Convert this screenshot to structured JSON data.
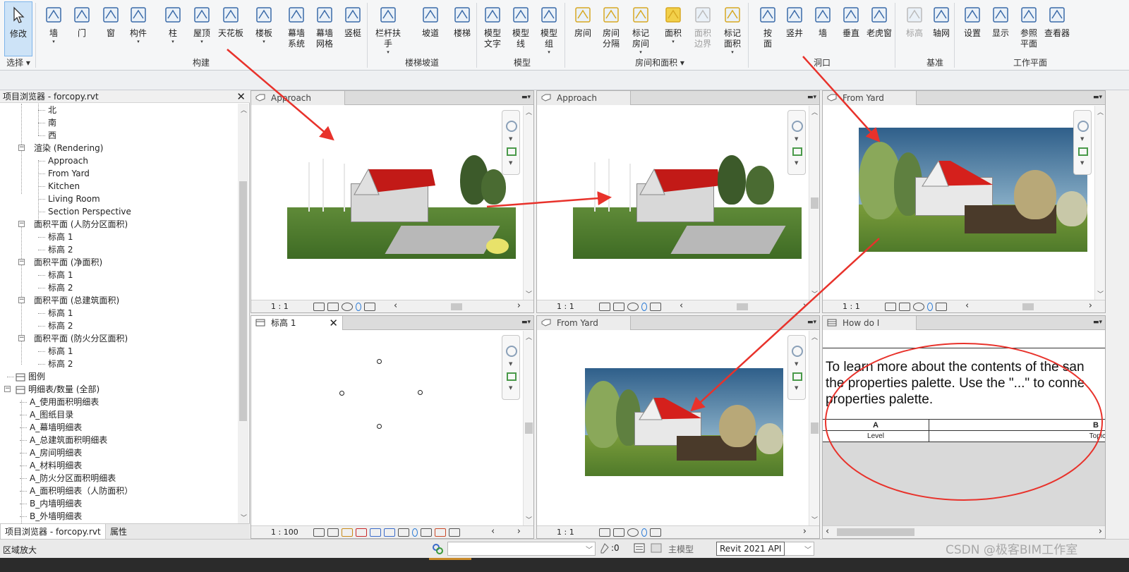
{
  "ribbon": {
    "tools": [
      {
        "label": "修改",
        "icon": "cursor-arrow-icon",
        "selected": true
      },
      {
        "label": "墙",
        "icon": "wall-icon",
        "dropdown": true
      },
      {
        "label": "门",
        "icon": "door-icon"
      },
      {
        "label": "窗",
        "icon": "window-icon"
      },
      {
        "label": "构件",
        "icon": "component-icon",
        "dropdown": true
      },
      {
        "label": "柱",
        "icon": "column-icon",
        "dropdown": true
      },
      {
        "label": "屋顶",
        "icon": "roof-icon",
        "dropdown": true
      },
      {
        "label": "天花板",
        "icon": "ceiling-icon"
      },
      {
        "label": "楼板",
        "icon": "floor-icon",
        "dropdown": true
      },
      {
        "label": "幕墙\n系统",
        "icon": "curtain-system-icon"
      },
      {
        "label": "幕墙\n网格",
        "icon": "curtain-grid-icon"
      },
      {
        "label": "竖梃",
        "icon": "mullion-icon"
      },
      {
        "label": "栏杆扶手",
        "icon": "railing-icon",
        "dropdown": true
      },
      {
        "label": "坡道",
        "icon": "ramp-icon"
      },
      {
        "label": "楼梯",
        "icon": "stair-icon"
      },
      {
        "label": "模型\n文字",
        "icon": "model-text-icon"
      },
      {
        "label": "模型\n线",
        "icon": "model-line-icon"
      },
      {
        "label": "模型\n组",
        "icon": "model-group-icon",
        "dropdown": true
      },
      {
        "label": "房间",
        "icon": "room-icon"
      },
      {
        "label": "房间\n分隔",
        "icon": "room-separator-icon"
      },
      {
        "label": "标记\n房间",
        "icon": "tag-room-icon",
        "dropdown": true
      },
      {
        "label": "面积",
        "icon": "area-icon",
        "dropdown": true
      },
      {
        "label": "面积\n边界",
        "icon": "area-boundary-icon",
        "disabled": true
      },
      {
        "label": "标记\n面积",
        "icon": "tag-area-icon",
        "dropdown": true
      },
      {
        "label": "按\n面",
        "icon": "by-face-icon"
      },
      {
        "label": "竖井",
        "icon": "shaft-icon"
      },
      {
        "label": "墙",
        "icon": "wall-opening-icon"
      },
      {
        "label": "垂直",
        "icon": "vertical-opening-icon"
      },
      {
        "label": "老虎窗",
        "icon": "dormer-icon"
      },
      {
        "label": "标高",
        "icon": "level-icon",
        "disabled": true
      },
      {
        "label": "轴网",
        "icon": "grid-icon"
      },
      {
        "label": "设置",
        "icon": "set-workplane-icon"
      },
      {
        "label": "显示",
        "icon": "show-workplane-icon"
      },
      {
        "label": "参照\n平面",
        "icon": "ref-plane-icon"
      },
      {
        "label": "查看器",
        "icon": "viewer-icon"
      }
    ],
    "panels": [
      "选择",
      "构建",
      "楼梯坡道",
      "模型",
      "房间和面积",
      "洞口",
      "基准",
      "工作平面"
    ]
  },
  "browser": {
    "title": "项目浏览器 - forcopy.rvt",
    "items": [
      {
        "label": "北",
        "level": 3,
        "type": "leaf"
      },
      {
        "label": "南",
        "level": 3,
        "type": "leaf"
      },
      {
        "label": "西",
        "level": 3,
        "type": "leaf"
      },
      {
        "label": "渲染 (Rendering)",
        "level": 2,
        "type": "group"
      },
      {
        "label": "Approach",
        "level": 3,
        "type": "leaf"
      },
      {
        "label": "From Yard",
        "level": 3,
        "type": "leaf"
      },
      {
        "label": "Kitchen",
        "level": 3,
        "type": "leaf"
      },
      {
        "label": "Living Room",
        "level": 3,
        "type": "leaf"
      },
      {
        "label": "Section Perspective",
        "level": 3,
        "type": "leaf"
      },
      {
        "label": "面积平面 (人防分区面积)",
        "level": 2,
        "type": "group"
      },
      {
        "label": "标高 1",
        "level": 3,
        "type": "leaf"
      },
      {
        "label": "标高 2",
        "level": 3,
        "type": "leaf"
      },
      {
        "label": "面积平面 (净面积)",
        "level": 2,
        "type": "group"
      },
      {
        "label": "标高 1",
        "level": 3,
        "type": "leaf"
      },
      {
        "label": "标高 2",
        "level": 3,
        "type": "leaf"
      },
      {
        "label": "面积平面 (总建筑面积)",
        "level": 2,
        "type": "group"
      },
      {
        "label": "标高 1",
        "level": 3,
        "type": "leaf"
      },
      {
        "label": "标高 2",
        "level": 3,
        "type": "leaf"
      },
      {
        "label": "面积平面 (防火分区面积)",
        "level": 2,
        "type": "group"
      },
      {
        "label": "标高 1",
        "level": 3,
        "type": "leaf"
      },
      {
        "label": "标高 2",
        "level": 3,
        "type": "leaf"
      },
      {
        "label": "图例",
        "level": 1,
        "type": "legend"
      },
      {
        "label": "明细表/数量 (全部)",
        "level": 1,
        "type": "schedule-group"
      },
      {
        "label": "A_使用面积明细表",
        "level": 2,
        "type": "leaf"
      },
      {
        "label": "A_图纸目录",
        "level": 2,
        "type": "leaf"
      },
      {
        "label": "A_幕墙明细表",
        "level": 2,
        "type": "leaf"
      },
      {
        "label": "A_总建筑面积明细表",
        "level": 2,
        "type": "leaf"
      },
      {
        "label": "A_房间明细表",
        "level": 2,
        "type": "leaf"
      },
      {
        "label": "A_材料明细表",
        "level": 2,
        "type": "leaf"
      },
      {
        "label": "A_防火分区面积明细表",
        "level": 2,
        "type": "leaf"
      },
      {
        "label": "A_面积明细表（人防面积）",
        "level": 2,
        "type": "leaf"
      },
      {
        "label": "B_内墙明细表",
        "level": 2,
        "type": "leaf"
      },
      {
        "label": "B_外墙明细表",
        "level": 2,
        "type": "leaf"
      }
    ],
    "tabs": [
      "项目浏览器 - forcopy.rvt",
      "属性"
    ]
  },
  "views": {
    "v1": {
      "title": "Approach",
      "scale": "1 : 1"
    },
    "v2": {
      "title": "Approach",
      "scale": "1 : 1"
    },
    "v3": {
      "title": "From Yard",
      "scale": "1 : 1"
    },
    "v4": {
      "title": "标高 1",
      "scale": "1 : 100"
    },
    "v5": {
      "title": "From Yard",
      "scale": "1 : 1"
    },
    "v6": {
      "title": "How do I",
      "text": "To learn more about the contents of the san\nthe properties palette.  Use the \"...\" to conne\nproperties palette.",
      "col_a": "A",
      "col_b": "B",
      "cell_a": "Level",
      "cell_b": "Topic"
    }
  },
  "statusbar": {
    "left_text": "区域放大",
    "filter_count": ":0",
    "main_model": "主模型",
    "tooltip": "Revit 2021 API",
    "watermark": "CSDN @极客BIM工作室"
  },
  "colors": {
    "annotation": "#e8322b",
    "roof": "#d5201c",
    "selection": "#cde3f7"
  }
}
